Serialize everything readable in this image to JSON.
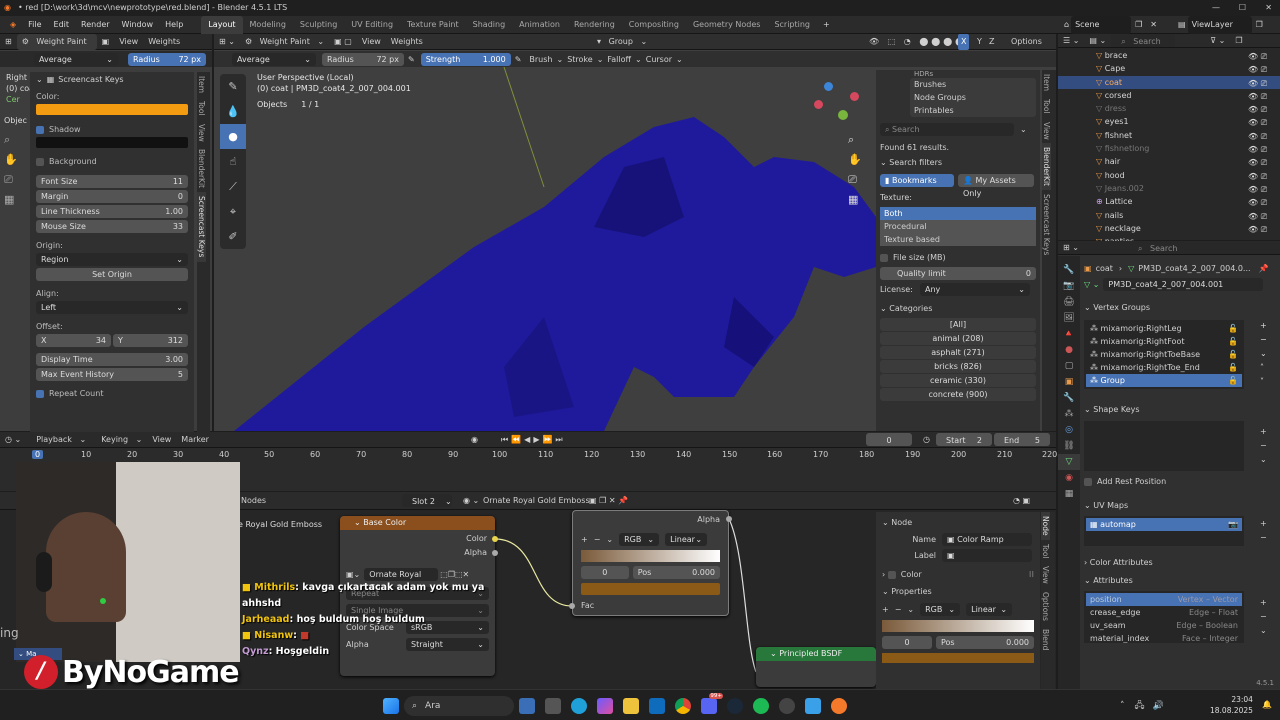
{
  "window": {
    "title": "• red [D:\\work\\3d\\mcv\\newprototype\\red.blend] - Blender 4.5.1 LTS"
  },
  "menu": [
    "File",
    "Edit",
    "Render",
    "Window",
    "Help"
  ],
  "workspaces": [
    "Layout",
    "Modeling",
    "Sculpting",
    "UV Editing",
    "Texture Paint",
    "Shading",
    "Animation",
    "Rendering",
    "Compositing",
    "Geometry Nodes",
    "Scripting"
  ],
  "scene": {
    "label": "Scene",
    "viewlayer": "ViewLayer"
  },
  "left_header": {
    "mode": "Weight Paint",
    "view": "View",
    "weights": "Weights",
    "blend": "Average",
    "radius_label": "Radius",
    "radius_value": "72 px"
  },
  "viewport_header": {
    "mode": "Weight Paint",
    "view": "View",
    "weights": "Weights",
    "group": "Group",
    "options": "Options"
  },
  "tool_header": {
    "blend": "Average",
    "radius_label": "Radius",
    "radius_value": "72 px",
    "strength_label": "Strength",
    "strength_value": "1.000",
    "brush": "Brush",
    "stroke": "Stroke",
    "falloff": "Falloff",
    "cursor": "Cursor"
  },
  "viewport": {
    "perspective": "User Perspective (Local)",
    "object": "(0) coat | PM3D_coat4_2_007_004.001",
    "objects_label": "Objects",
    "objects_value": "1 / 1"
  },
  "screencast": {
    "title": "Screencast Keys",
    "color_label": "Color:",
    "color": "#f39c12",
    "shadow": "Shadow",
    "background": "Background",
    "font_size_label": "Font Size",
    "font_size": "11",
    "margin_label": "Margin",
    "margin": "0",
    "line_thickness_label": "Line Thickness",
    "line_thickness": "1.00",
    "mouse_size_label": "Mouse Size",
    "mouse_size": "33",
    "origin_label": "Origin:",
    "origin": "Region",
    "set_origin": "Set Origin",
    "align_label": "Align:",
    "align": "Left",
    "offset_label": "Offset:",
    "x_label": "X",
    "x": "34",
    "y_label": "Y",
    "y": "312",
    "display_time_label": "Display Time",
    "display_time": "3.00",
    "max_history_label": "Max Event History",
    "max_history": "5",
    "repeat_count": "Repeat Count",
    "tabs": [
      "Item",
      "Tool",
      "View",
      "BlenderKit",
      "Screencast Keys"
    ],
    "overlay_partial": [
      "Right C",
      "(0) coa",
      "Cer",
      "Objec"
    ]
  },
  "viewport_tabs": [
    "Item",
    "Tool",
    "View",
    "BlenderKit",
    "Screencast Keys"
  ],
  "assets": {
    "list": [
      "Brushes",
      "Node Groups",
      "Printables"
    ],
    "top_partial": "HDRs",
    "search_placeholder": "Search",
    "found": "Found 61 results.",
    "search_filters": "Search filters",
    "bookmarks": "Bookmarks",
    "my_assets": "My Assets Only",
    "texture_label": "Texture:",
    "texture_options": [
      "Both",
      "Procedural",
      "Texture based"
    ],
    "file_size": "File size (MB)",
    "quality_label": "Quality limit",
    "quality_value": "0",
    "license_label": "License:",
    "license_value": "Any",
    "categories": "Categories",
    "category_items": [
      "[All]",
      "animal (208)",
      "asphalt (271)",
      "bricks (826)",
      "ceramic (330)",
      "concrete (900)"
    ]
  },
  "outliner": {
    "search_placeholder": "Search",
    "items": [
      {
        "name": "brace"
      },
      {
        "name": "Cape"
      },
      {
        "name": "coat"
      },
      {
        "name": "corsed"
      },
      {
        "name": "dress"
      },
      {
        "name": "eyes1"
      },
      {
        "name": "fishnet"
      },
      {
        "name": "fishnetlong"
      },
      {
        "name": "hair"
      },
      {
        "name": "hood"
      },
      {
        "name": "Jeans.002"
      },
      {
        "name": "Lattice"
      },
      {
        "name": "nails"
      },
      {
        "name": "necklage"
      },
      {
        "name": "panties"
      }
    ]
  },
  "properties": {
    "search_placeholder": "Search",
    "breadcrumb_object": "coat",
    "breadcrumb_mesh": "PM3D_coat4_2_007_004.0...",
    "mesh_name": "PM3D_coat4_2_007_004.001",
    "vertex_groups_title": "Vertex Groups",
    "vertex_groups": [
      "mixamorig:RightLeg",
      "mixamorig:RightFoot",
      "mixamorig:RightToeBase",
      "mixamorig:RightToe_End",
      "Group"
    ],
    "shape_keys_title": "Shape Keys",
    "add_rest_position": "Add Rest Position",
    "uv_maps_title": "UV Maps",
    "uv_map": "automap",
    "color_attributes_title": "Color Attributes",
    "attributes_title": "Attributes",
    "attributes": [
      {
        "name": "position",
        "domain": "Vertex",
        "type": "Vector"
      },
      {
        "name": "crease_edge",
        "domain": "Edge",
        "type": "Float"
      },
      {
        "name": "uv_seam",
        "domain": "Edge",
        "type": "Boolean"
      },
      {
        "name": "material_index",
        "domain": "Face",
        "type": "Integer"
      }
    ],
    "version": "4.5.1"
  },
  "timeline": {
    "menus": [
      "Playback",
      "Keying",
      "View",
      "Marker"
    ],
    "frame": "0",
    "start_label": "Start",
    "start": "2",
    "end_label": "End",
    "end": "5",
    "current": "0",
    "ticks": [
      "10",
      "20",
      "30",
      "40",
      "50",
      "60",
      "70",
      "80",
      "90",
      "100",
      "110",
      "120",
      "130",
      "140",
      "150",
      "160",
      "170",
      "180",
      "190",
      "200",
      "210",
      "220"
    ]
  },
  "node_editor": {
    "slot": "Slot 2",
    "material": "Ornate Royal Gold Emboss",
    "left_partial": "Nodes",
    "frame_label": "e Royal Gold Emboss",
    "base_color_node": "Base Color",
    "socket_color": "Color",
    "socket_alpha": "Alpha",
    "image_name": "Ornate Royal Go...",
    "repeat": "Repeat",
    "single_image": "Single Image",
    "color_space_label": "Color Space",
    "color_space": "sRGB",
    "alpha_label": "Alpha",
    "alpha_mode": "Straight",
    "ramp_alpha": "Alpha",
    "ramp_mode": "RGB",
    "ramp_interp": "Linear",
    "ramp_index": "0",
    "ramp_pos_label": "Pos",
    "ramp_pos": "0.000",
    "fac": "Fac",
    "principled": "Principled BSDF",
    "side_node_title": "Node",
    "name_label": "Name",
    "name_value": "Color Ramp",
    "label_label": "Label",
    "color_label": "Color",
    "properties_title": "Properties",
    "side_mode": "RGB",
    "side_interp": "Linear",
    "side_index": "0",
    "side_pos_label": "Pos",
    "side_pos": "0.000",
    "tabs": [
      "Node",
      "Tool",
      "View",
      "Options",
      "Blend"
    ]
  },
  "chat": [
    {
      "user": "Mithrils",
      "color": "#f1c40f",
      "text": ": kavga çıkartacak adam yok mu ya ahhshd"
    },
    {
      "user": "Jarheaad",
      "color": "#f1c40f",
      "text": ": hoş buldum hoş buldum"
    },
    {
      "user": "Nisanw",
      "color": "#f1c40f",
      "text": ":"
    },
    {
      "user": "Qynz",
      "color": "#c39bd3",
      "text": ": Hoşgeldin"
    }
  ],
  "overlay": {
    "logo": "ByNoGame",
    "webcam_tag": "Ma",
    "partial_text": "ing"
  },
  "taskbar": {
    "search_placeholder": "Ara",
    "time": "23:04",
    "date": "18.08.2025",
    "badge": "99+"
  }
}
